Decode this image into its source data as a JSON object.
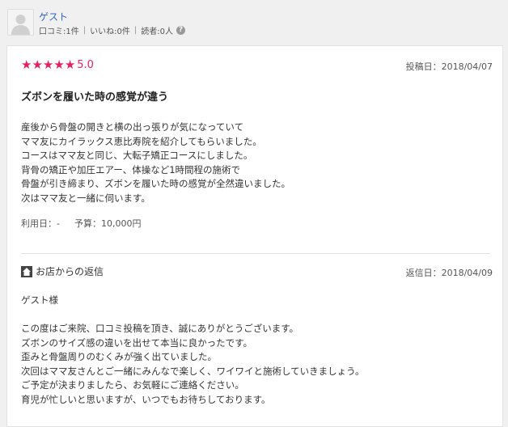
{
  "user": {
    "name": "ゲスト",
    "reviews": "口コミ:1件",
    "likes": "いいね:0件",
    "readers": "読者:0人",
    "help_icon": "question-icon"
  },
  "review": {
    "stars": 5,
    "rating": "5.0",
    "post_date": "投稿日：2018/04/07",
    "title": "ズボンを履いた時の感覚が違う",
    "body": [
      "産後から骨盤の開きと横の出っ張りが気になっていて",
      "ママ友にカイラックス恵比寿院を紹介してもらいました。",
      "コースはママ友と同じ、大転子矯正コースにしました。",
      "背骨の矯正や加圧エアー、体操など1時間程の施術で",
      "骨盤が引き締まり、ズボンを履いた時の感覚が全然違いました。",
      "次はママ友と一緒に伺います。"
    ],
    "use_date": "利用日：-",
    "budget": "予算：10,000円"
  },
  "reply": {
    "label": "お店からの返信",
    "icon": "house-icon",
    "date": "返信日：2018/04/09",
    "body": [
      "ゲスト様",
      "",
      "この度はご来院、口コミ投稿を頂き、誠にありがとうございます。",
      "ズボンのサイズ感の違いを出せて本当に良かったです。",
      "歪みと骨盤周りのむくみが強く出ていました。",
      "次回はママ友さんとご一緒にみんなで楽しく、ワイワイと施術していきましょう。",
      "ご予定が決まりましたら、お気軽にご連絡ください。",
      "育児が忙しいと思いますが、いつでもお待ちしております。"
    ]
  },
  "colors": {
    "accent": "#e4205f",
    "link": "#3366cc"
  }
}
